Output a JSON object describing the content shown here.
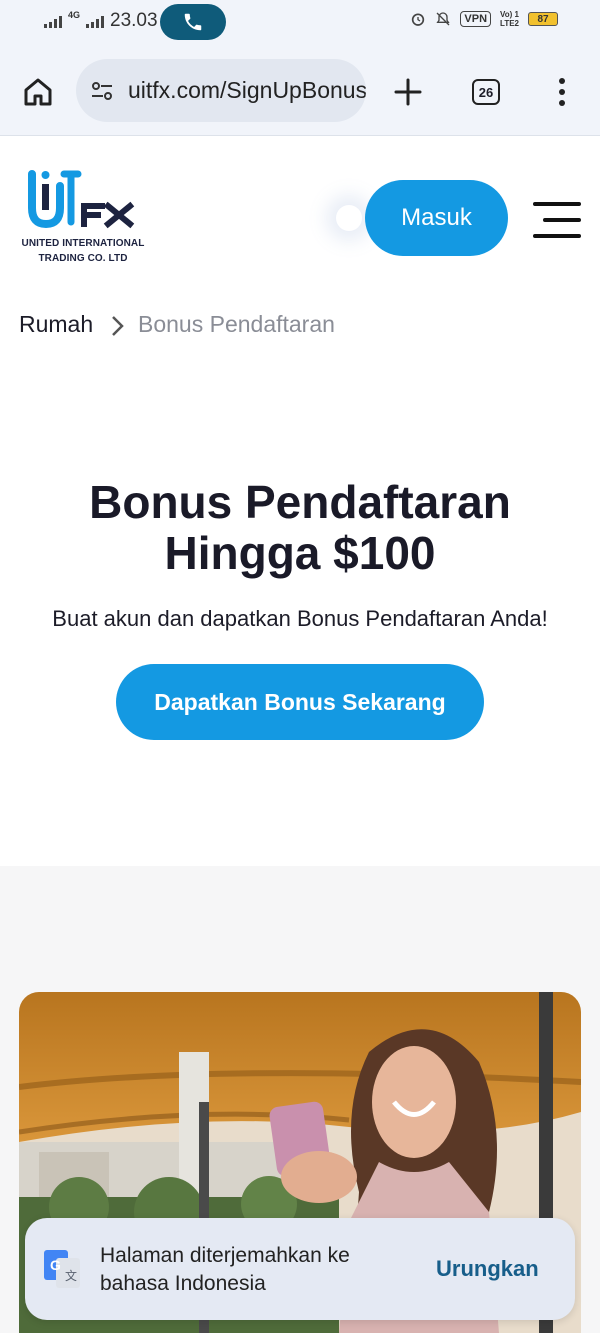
{
  "status_bar": {
    "network": "4G",
    "time": "23.03",
    "vpn": "VPN",
    "volte_top": "Vo) 1",
    "volte_bottom": "LTE2",
    "battery": "87"
  },
  "browser": {
    "url": "uitfx.com/SignUpBonus",
    "tab_count": "26"
  },
  "site": {
    "logo_line1": "UNITED INTERNATIONAL",
    "logo_line2": "TRADING CO. LTD",
    "login_label": "Masuk",
    "brand_color": "#1499e2"
  },
  "breadcrumb": {
    "home": "Rumah",
    "current": "Bonus Pendaftaran"
  },
  "hero": {
    "title_line1": "Bonus Pendaftaran",
    "title_line2": "Hingga $100",
    "subtitle": "Buat akun dan dapatkan Bonus Pendaftaran Anda!",
    "cta_label": "Dapatkan Bonus Sekarang"
  },
  "translate_toast": {
    "line1": "Halaman diterjemahkan ke",
    "line2": "bahasa Indonesia",
    "action": "Urungkan"
  }
}
